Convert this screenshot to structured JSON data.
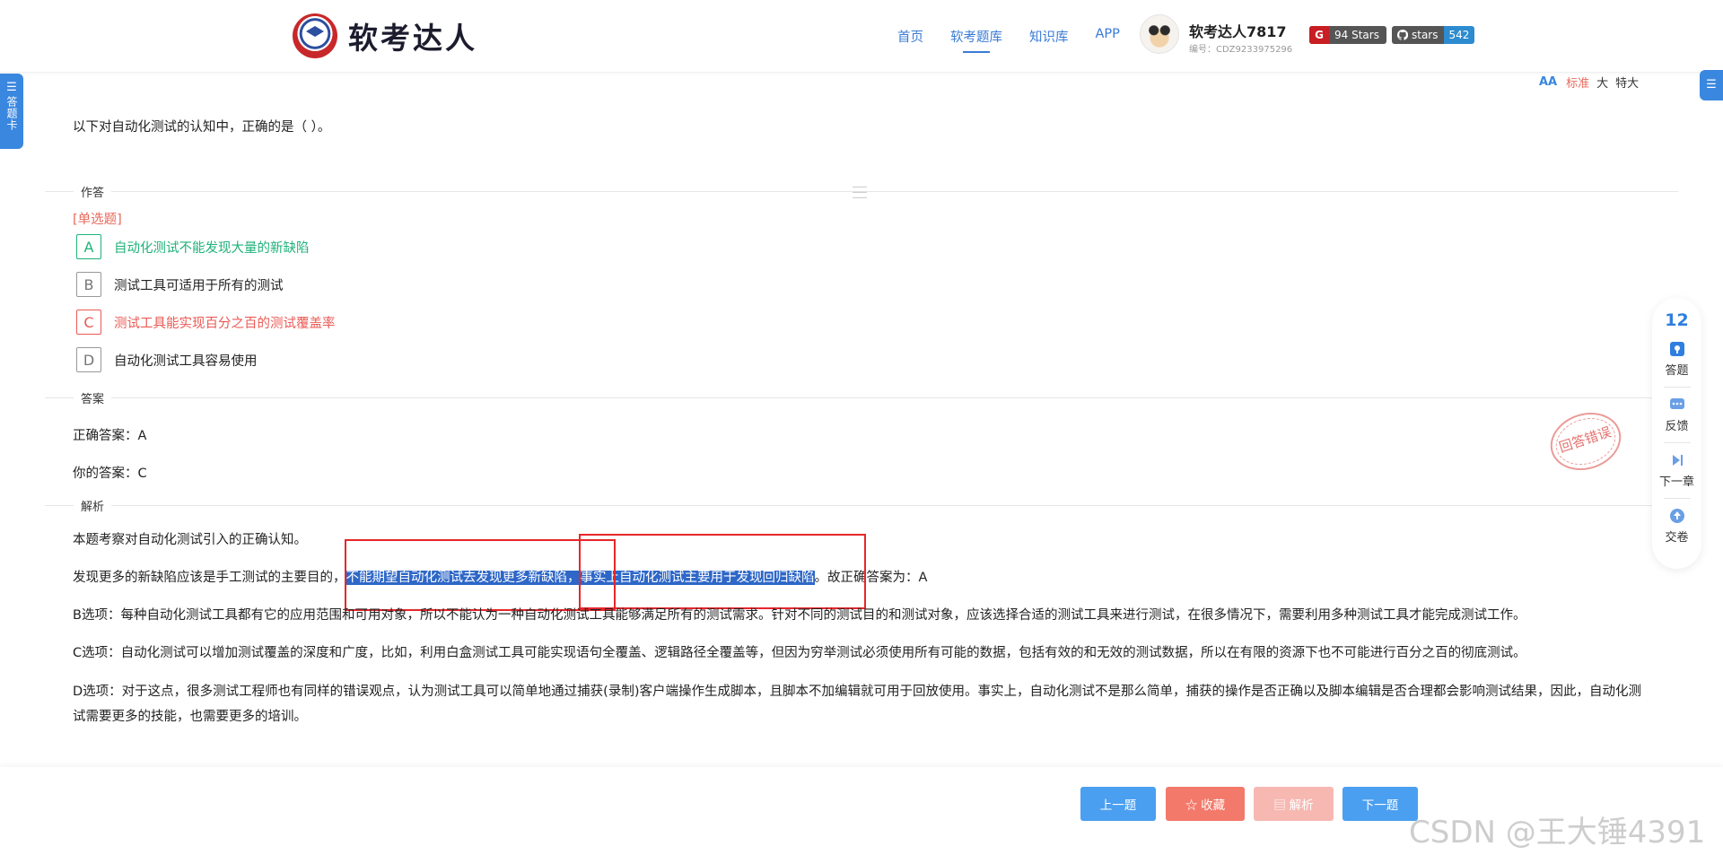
{
  "header": {
    "logo_text": "软考达人",
    "nav": [
      "首页",
      "软考题库",
      "知识库",
      "APP"
    ],
    "nav_active": 1,
    "user_name": "软考达人7817",
    "user_id": "编号：CDZ9233975296",
    "gitee_badge": "94 Stars",
    "github_badge_label": "stars",
    "github_badge_count": "542"
  },
  "left_tab": {
    "label": "答题卡",
    "glyph": "☰"
  },
  "right_tab": {
    "glyph": "☰"
  },
  "font_size": {
    "icon": "AA",
    "options": [
      "标准",
      "大",
      "特大"
    ],
    "selected": 0
  },
  "question": {
    "text": "以下对自动化测试的认知中，正确的是（ ）。",
    "section_answer_label": "作答",
    "type": "[单选题]",
    "options": [
      {
        "key": "A",
        "text": "自动化测试不能发现大量的新缺陷",
        "state": "correct"
      },
      {
        "key": "B",
        "text": "测试工具可适用于所有的测试",
        "state": "normal"
      },
      {
        "key": "C",
        "text": "测试工具能实现百分之百的测试覆盖率",
        "state": "wrong"
      },
      {
        "key": "D",
        "text": "自动化测试工具容易使用",
        "state": "normal"
      }
    ]
  },
  "answer": {
    "section_label": "答案",
    "correct": "正确答案：A",
    "yours": "你的答案：C",
    "stamp": "回答错误"
  },
  "analysis": {
    "section_label": "解析",
    "p1": "本题考察对自动化测试引入的正确认知。",
    "p2_before": "发现更多的新缺陷应该是手工测试的主要目的，",
    "p2_hl": "不能期望自动化测试去发现更多新缺陷，事实上自动化测试主要用于发现回归缺陷",
    "p2_after": "。故正确答案为：A",
    "p3": "B选项：每种自动化测试工具都有它的应用范围和可用对象，所以不能认为一种自动化测试工具能够满足所有的测试需求。针对不同的测试目的和测试对象，应该选择合适的测试工具来进行测试，在很多情况下，需要利用多种测试工具才能完成测试工作。",
    "p4": "C选项：自动化测试可以增加测试覆盖的深度和广度，比如，利用白盒测试工具可能实现语句全覆盖、逻辑路径全覆盖等，但因为穷举测试必须使用所有可能的数据，包括有效的和无效的测试数据，所以在有限的资源下也不可能进行百分之百的彻底测试。",
    "p5": "D选项：对于这点，很多测试工程师也有同样的错误观点，认为测试工具可以简单地通过捕获(录制)客户端操作生成脚本，且脚本不加编辑就可用于回放使用。事实上，自动化测试不是那么简单，捕获的操作是否正确以及脚本编辑是否合理都会影响测试结果，因此，自动化测试需要更多的技能，也需要更多的培训。"
  },
  "float_bar": {
    "count": "12",
    "items": [
      "答题",
      "反馈",
      "下一章",
      "交卷"
    ]
  },
  "bottom": {
    "prev": "上一题",
    "fav": "☆ 收藏",
    "analysis": "▤ 解析",
    "next": "下一题"
  },
  "watermark": "CSDN @王大锤4391"
}
